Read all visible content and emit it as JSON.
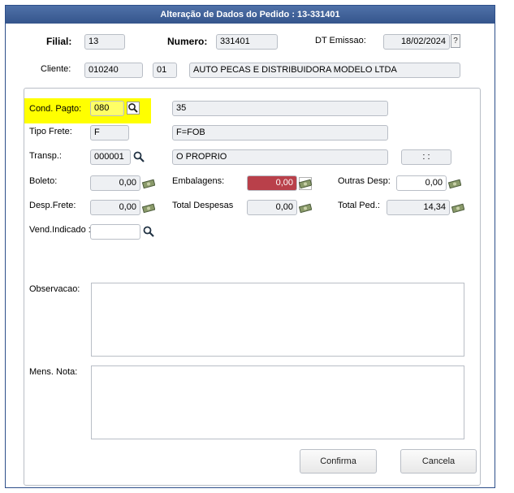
{
  "window": {
    "title": "Alteração de Dados do Pedido : 13-331401"
  },
  "header": {
    "filial_label": "Filial:",
    "filial_value": "13",
    "numero_label": "Numero:",
    "numero_value": "331401",
    "dt_emissao_label": "DT Emissao:",
    "dt_emissao_value": "18/02/2024",
    "help_label": "?",
    "cliente_label": "Cliente:",
    "cliente_code": "010240",
    "cliente_store": "01",
    "cliente_name": "AUTO PECAS E DISTRIBUIDORA MODELO LTDA"
  },
  "form": {
    "cond_pagto_label": "Cond. Pagto:",
    "cond_pagto_value": "080",
    "cond_pagto_desc": "35",
    "tipo_frete_label": "Tipo Frete:",
    "tipo_frete_value": "F",
    "tipo_frete_desc": "F=FOB",
    "transp_label": "Transp.:",
    "transp_value": "000001",
    "transp_desc": "O PROPRIO",
    "transp_extra": " :  : ",
    "boleto_label": "Boleto:",
    "boleto_value": "0,00",
    "embalagens_label": "Embalagens:",
    "embalagens_value": "0,00",
    "outras_desp_label": "Outras Desp:",
    "outras_desp_value": "0,00",
    "desp_frete_label": "Desp.Frete:",
    "desp_frete_value": "0,00",
    "total_despesas_label": "Total Despesas",
    "total_despesas_value": "0,00",
    "total_ped_label": "Total Ped.:",
    "total_ped_value": "14,34",
    "vend_indicado_label": "Vend.Indicado :",
    "vend_indicado_value": "",
    "observacao_label": "Observacao:",
    "mens_nota_label": "Mens. Nota:"
  },
  "buttons": {
    "confirma": "Confirma",
    "cancela": "Cancela"
  },
  "colors": {
    "titlebar": "#3d5f96",
    "highlight": "#ffff00",
    "embalagens_bg": "#b9404a"
  }
}
